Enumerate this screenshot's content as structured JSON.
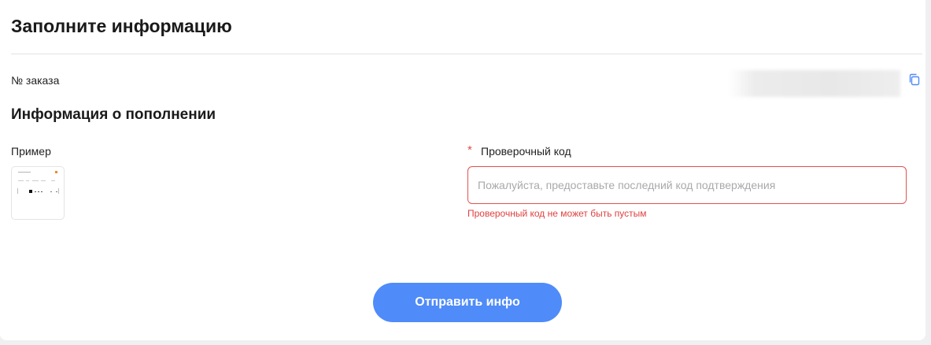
{
  "page": {
    "title": "Заполните информацию"
  },
  "order": {
    "label": "№ заказа",
    "value": "",
    "copy_icon": "copy-icon"
  },
  "recharge": {
    "section_title": "Информация о пополнении",
    "example_label": "Пример",
    "verification": {
      "required_mark": "*",
      "label": "Проверочный код",
      "value": "",
      "placeholder": "Пожалуйста, предоставьте последний код подтверждения",
      "error": "Проверочный код не может быть пустым"
    }
  },
  "actions": {
    "submit_label": "Отправить инфо"
  },
  "colors": {
    "accent": "#4f8bf9",
    "error": "#e05252",
    "copy_icon": "#4f8bf9"
  }
}
